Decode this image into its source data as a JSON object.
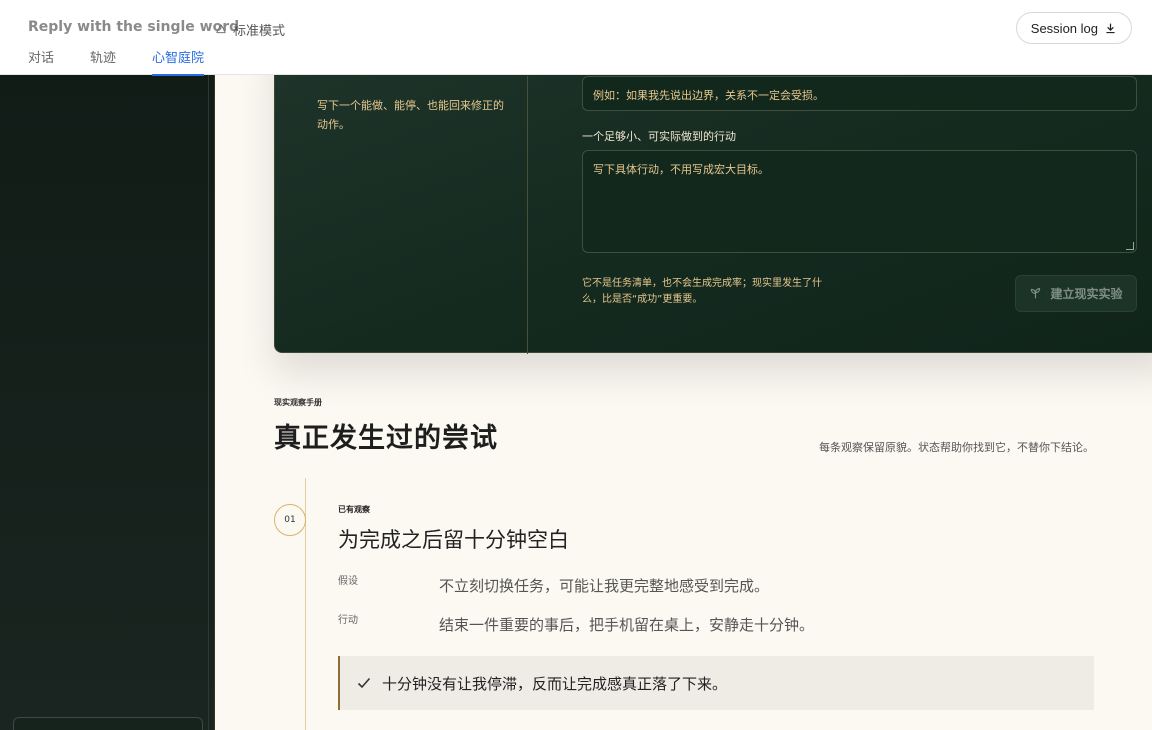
{
  "header": {
    "app_title": "Reply with the single word",
    "mode_label": "标准模式",
    "session_button": "Session log",
    "tabs": [
      {
        "label": "对话"
      },
      {
        "label": "轨迹"
      },
      {
        "label": "心智庭院"
      }
    ],
    "active_tab": "心智庭院"
  },
  "form": {
    "note": "写下一个能做、能停、也能回来修正的动作。",
    "example_value": "例如：如果我先说出边界，关系不一定会受损。",
    "action_label": "一个足够小、可实际做到的行动",
    "action_placeholder": "写下具体行动，不用写成宏大目标。",
    "hint": "它不是任务清单，也不会生成完成率；现实里发生了什么，比是否“成功”更重要。",
    "create_button": "建立现实实验"
  },
  "section": {
    "eyebrow": "现实观察手册",
    "title": "真正发生过的尝试",
    "subtitle": "每条观察保留原貌。状态帮助你找到它，不替你下结论。"
  },
  "observation": {
    "number": "01",
    "status": "已有观察",
    "title": "为完成之后留十分钟空白",
    "hypothesis_label": "假设",
    "hypothesis": "不立刻切换任务，可能让我更完整地感受到完成。",
    "action_label": "行动",
    "action": "结束一件重要的事后，把手机留在桌上，安静走十分钟。",
    "result": "十分钟没有让我停滞，反而让完成感真正落了下来。"
  },
  "colors": {
    "accent": "#2b6de0",
    "dark_green": "#142a1f",
    "gold": "#e5c78e"
  }
}
